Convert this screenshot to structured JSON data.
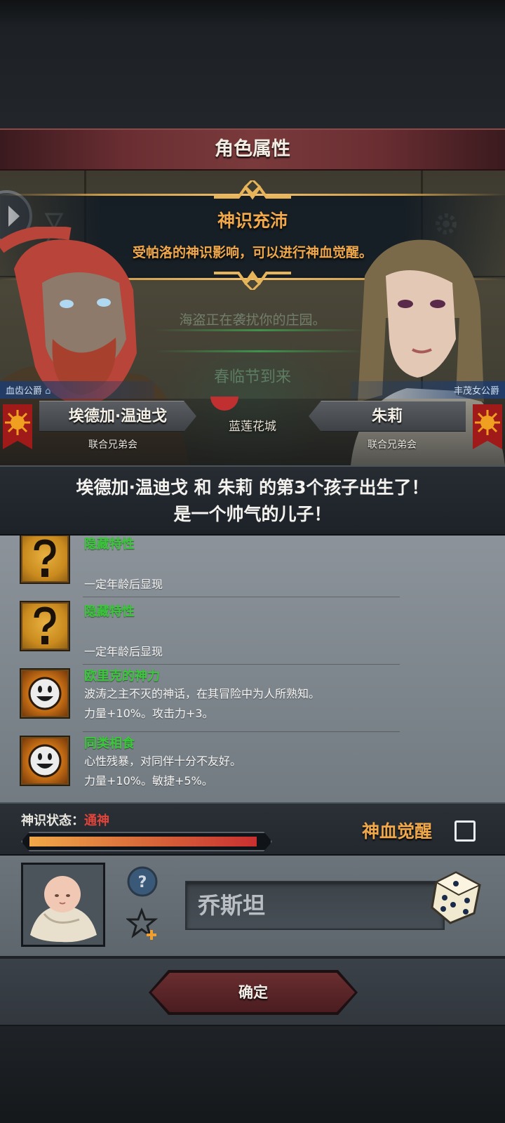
{
  "header": {
    "title": "角色属性"
  },
  "event": {
    "title": "神识充沛",
    "description": "受帕洛的神识影响，可以进行神血觉醒。",
    "background_message": "海盗正在袭扰你的庄园。",
    "background_festival": "春临节到来"
  },
  "parents": {
    "father": {
      "title": "血齿公爵",
      "name": "埃德加·温迪戈",
      "guild": "联合兄弟会"
    },
    "mother": {
      "title": "丰茂女公爵",
      "name": "朱莉",
      "guild": "联合兄弟会"
    },
    "city": "蓝莲花城"
  },
  "birth": {
    "line1": "埃德加·温迪戈 和 朱莉 的第3个孩子出生了！",
    "line2": "是一个帅气的儿子！"
  },
  "traits": [
    {
      "icon": "question-icon",
      "name": "隐藏特性",
      "desc1": "",
      "desc2": "一定年龄后显现"
    },
    {
      "icon": "question-icon",
      "name": "隐藏特性",
      "desc1": "",
      "desc2": "一定年龄后显现"
    },
    {
      "icon": "smiley-sun-icon",
      "name": "欧里克的神力",
      "desc1": "波涛之主不灭的神话，在其冒险中为人所熟知。",
      "desc2": "力量+10%。攻击力+3。"
    },
    {
      "icon": "smiley-sun-icon",
      "name": "同类相食",
      "desc1": "心性残暴，对同伴十分不友好。",
      "desc2": "力量+10%。敏捷+5%。"
    }
  ],
  "divine": {
    "label": "神识状态：",
    "value": "通神",
    "progress": 0.97,
    "awaken_label": "神血觉醒",
    "awaken_checked": false
  },
  "child": {
    "name": "乔斯坦"
  },
  "confirm": {
    "label": "确定"
  },
  "colors": {
    "accent_orange": "#f0a84a",
    "trait_green": "#3ac83a",
    "state_red": "#e0443a",
    "header_red": "#6a2e32"
  }
}
